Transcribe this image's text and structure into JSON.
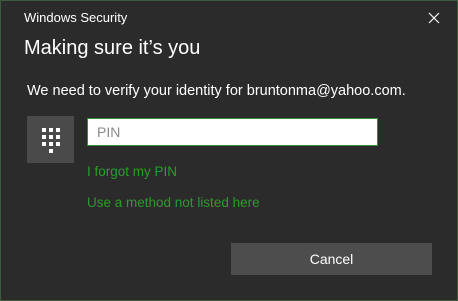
{
  "window": {
    "title": "Windows Security"
  },
  "dialog": {
    "heading": "Making sure it’s you",
    "message": "We need to verify your identity for bruntonma@yahoo.com.",
    "pin_input": {
      "value": "",
      "placeholder": "PIN"
    },
    "links": {
      "forgot_pin": "I forgot my PIN",
      "other_method": "Use a method not listed here"
    },
    "cancel_label": "Cancel"
  },
  "icons": {
    "keypad": "keypad-icon",
    "close": "close-icon"
  },
  "colors": {
    "background": "#2b2b2b",
    "link": "#2d9a2d",
    "button": "#4d4d4d",
    "keypad_tile": "#4a4a4a"
  }
}
